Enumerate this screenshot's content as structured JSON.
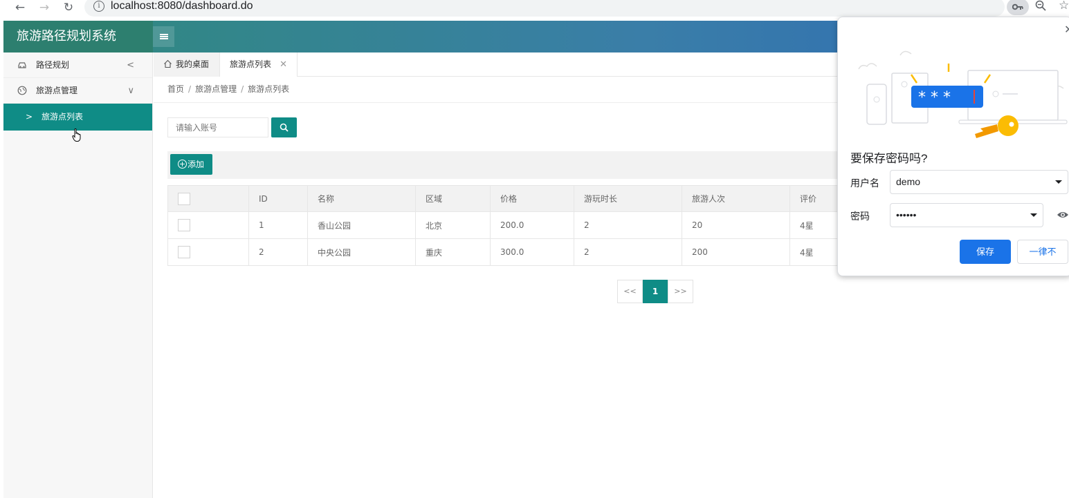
{
  "browser": {
    "url": "localhost:8080/dashboard.do",
    "info_glyph": "i"
  },
  "app": {
    "title": "旅游路径规划系统",
    "accent_color": "#0f8c86"
  },
  "sidebar": {
    "items": [
      {
        "label": "路径规划",
        "icon": "car-icon",
        "arrow": "<"
      },
      {
        "label": "旅游点管理",
        "icon": "globe-icon",
        "arrow": "∨"
      }
    ],
    "subitems": [
      {
        "label": "旅游点列表",
        "chevron": ">"
      }
    ]
  },
  "tabs": [
    {
      "label": "我的桌面",
      "icon": "home-icon"
    },
    {
      "label": "旅游点列表",
      "close": "✕"
    }
  ],
  "breadcrumb": [
    "首页",
    "旅游点管理",
    "旅游点列表"
  ],
  "breadcrumb_sep": "/",
  "search": {
    "placeholder": "请输入账号"
  },
  "toolbar": {
    "add_label": "添加",
    "add_icon": "+"
  },
  "table": {
    "headers": [
      "ID",
      "名称",
      "区域",
      "价格",
      "游玩时长",
      "旅游人次",
      "评价"
    ],
    "rows": [
      [
        "1",
        "香山公园",
        "北京",
        "200.0",
        "2",
        "20",
        "4星"
      ],
      [
        "2",
        "中央公园",
        "重庆",
        "300.0",
        "2",
        "200",
        "4星"
      ]
    ]
  },
  "pager": {
    "prev": "<<",
    "current": "1",
    "next": ">>"
  },
  "password_popup": {
    "title": "要保存密码吗?",
    "username_label": "用户名",
    "username_value": "demo",
    "password_label": "密码",
    "password_value": "••••••",
    "save_label": "保存",
    "never_label": "一律不",
    "close": "✕",
    "illustration_text": "* * *"
  }
}
